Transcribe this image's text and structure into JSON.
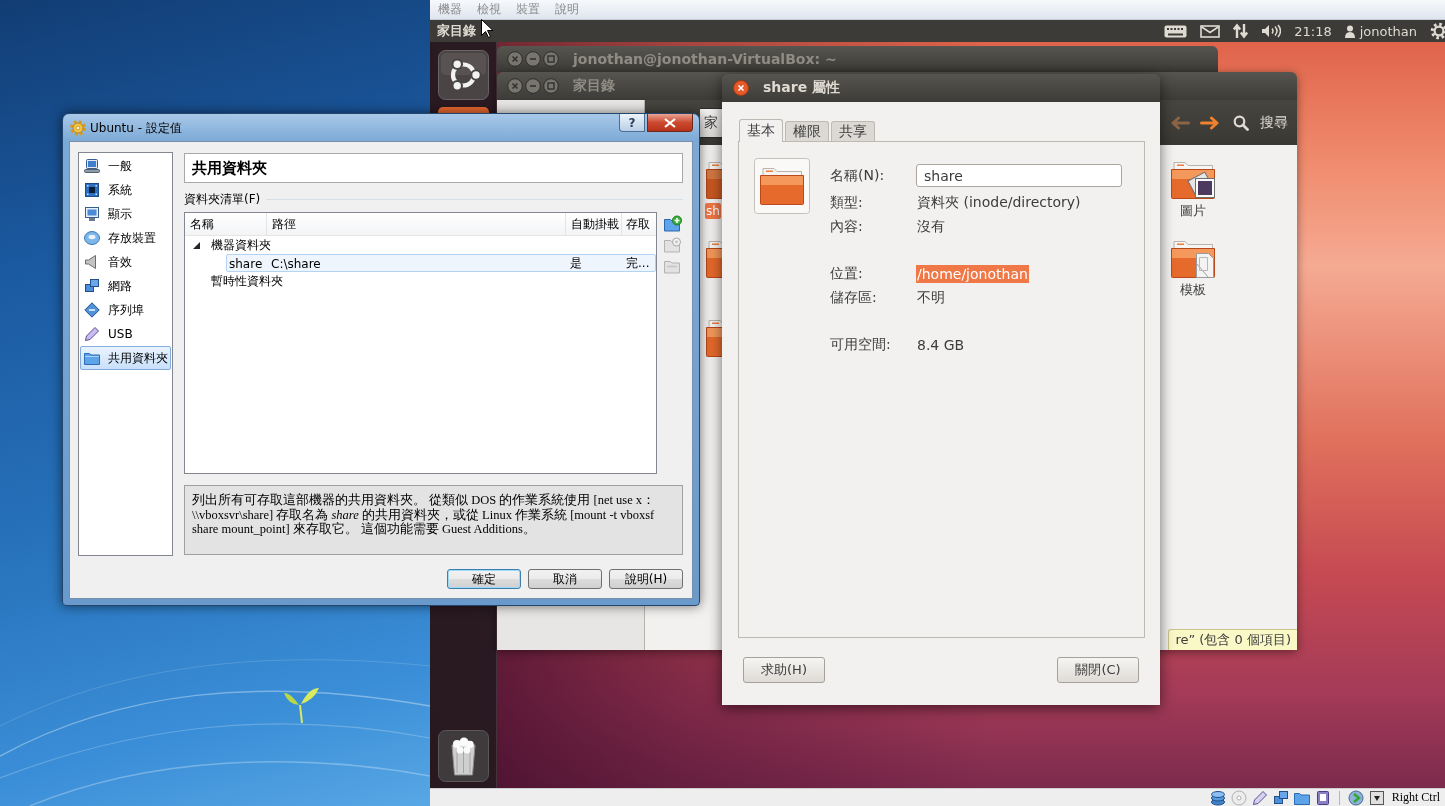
{
  "vm_menu": [
    "機器",
    "檢視",
    "裝置",
    "說明"
  ],
  "guest_top_panel": {
    "app_title": "家目錄",
    "clock": "21:18",
    "user": "jonothan"
  },
  "terminal_window": {
    "title": "jonothan@jonothan-VirtualBox: ~"
  },
  "file_manager": {
    "title": "家目錄",
    "path_button": "家",
    "nav_buttons": [
      {
        "kind": "back",
        "disabled": true
      },
      {
        "kind": "forward",
        "disabled": false
      }
    ],
    "search_label": "搜尋",
    "cut_items": [
      {
        "label": "sh",
        "selected": true
      },
      {
        "selected": false
      },
      {
        "selected": false
      }
    ],
    "items": [
      {
        "kind": "pictures",
        "label": "圖片",
        "selected": false
      },
      {
        "kind": "templates",
        "label": "模板",
        "selected": false
      }
    ],
    "status": "re” (包含 0 個項目)"
  },
  "properties_dialog": {
    "title": "share 屬性",
    "tabs": [
      {
        "label": "基本",
        "selected": true
      },
      {
        "label": "權限",
        "selected": false
      },
      {
        "label": "共享",
        "selected": false
      }
    ],
    "groups": [
      {
        "rows": [
          {
            "label": "名稱(N):",
            "kind": "entry",
            "value": "share",
            "selected": false
          },
          {
            "label": "類型:",
            "kind": "text",
            "value": "資料夾 (inode/directory)",
            "selected": false
          },
          {
            "label": "內容:",
            "kind": "text",
            "value": "沒有",
            "selected": false
          }
        ]
      },
      {
        "rows": [
          {
            "label": "位置:",
            "kind": "text",
            "value": "/home/jonothan",
            "selected": true
          },
          {
            "label": "儲存區:",
            "kind": "text",
            "value": "不明",
            "selected": false
          }
        ]
      },
      {
        "rows": [
          {
            "label": "可用空間:",
            "kind": "text",
            "value": "8.4 GB",
            "selected": false
          }
        ]
      }
    ],
    "buttons": [
      "求助(H)",
      "關閉(C)"
    ]
  },
  "settings_dialog": {
    "title": "Ubuntu - 設定值",
    "help_button": "?",
    "categories": [
      {
        "kind": "general",
        "label": "一般",
        "selected": false
      },
      {
        "kind": "system",
        "label": "系統",
        "selected": false
      },
      {
        "kind": "display",
        "label": "顯示",
        "selected": false
      },
      {
        "kind": "storage",
        "label": "存放裝置",
        "selected": false
      },
      {
        "kind": "audio",
        "label": "音效",
        "selected": false
      },
      {
        "kind": "network",
        "label": "網路",
        "selected": false
      },
      {
        "kind": "serial",
        "label": "序列埠",
        "selected": false
      },
      {
        "kind": "usb",
        "label": "USB",
        "selected": false
      },
      {
        "kind": "shared",
        "label": "共用資料夾",
        "selected": true
      }
    ],
    "page_title": "共用資料夾",
    "group_label": "資料夾清單(F)",
    "columns": [
      "名稱",
      "路徑",
      "自動掛載",
      "存取"
    ],
    "tree": [
      {
        "label": "機器資料夾",
        "expanded": true,
        "children": [
          {
            "name": "share",
            "path": "C:\\share",
            "auto_mount": "是",
            "access": "完...",
            "selected": true
          }
        ]
      },
      {
        "label": "暫時性資料夾",
        "expanded": false
      }
    ],
    "actions": [
      {
        "kind": "add",
        "disabled": false
      },
      {
        "kind": "edit",
        "disabled": true
      },
      {
        "kind": "remove",
        "disabled": true
      }
    ],
    "info": "列出所有可存取這部機器的共用資料夾。 從類似 DOS 的作業系統使用 [net use x： \\\\vboxsvr\\share] 存取名為 *share* 的共用資料夾，或從 Linux 作業系統 [mount -t vboxsf share mount_point] 來存取它。 這個功能需要 Guest Additions。",
    "buttons": [
      {
        "label": "確定",
        "default": true
      },
      {
        "label": "取消",
        "default": false
      },
      {
        "label": "說明(H)",
        "default": false
      }
    ]
  },
  "vm_status_bar": {
    "host_key": "Right Ctrl"
  }
}
